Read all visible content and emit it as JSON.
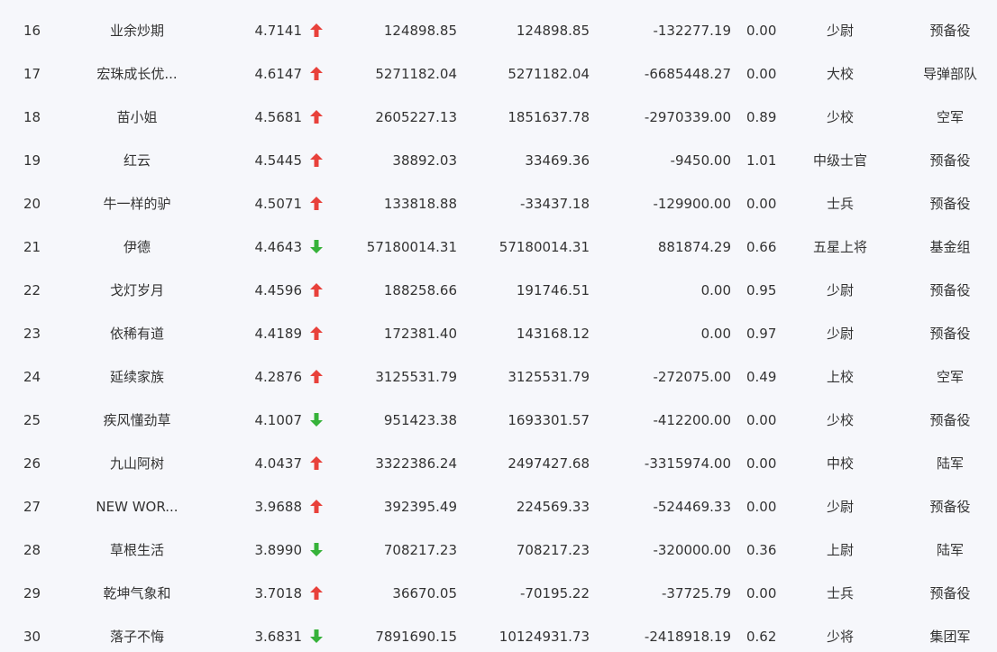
{
  "colors": {
    "background": "#f6f7fb",
    "text": "#333333",
    "up_arrow": "#e8413b",
    "down_arrow": "#36b23a"
  },
  "rows": [
    {
      "rank": "16",
      "name": "业余炒期",
      "score": "4.7141",
      "trend": "up",
      "trend_icon": "arrow-up-icon",
      "v1": "124898.85",
      "v2": "124898.85",
      "v3": "-132277.19",
      "ratio": "0.00",
      "rank_title": "少尉",
      "unit": "预备役"
    },
    {
      "rank": "17",
      "name": "宏珠成长优...",
      "score": "4.6147",
      "trend": "up",
      "trend_icon": "arrow-up-icon",
      "v1": "5271182.04",
      "v2": "5271182.04",
      "v3": "-6685448.27",
      "ratio": "0.00",
      "rank_title": "大校",
      "unit": "导弹部队"
    },
    {
      "rank": "18",
      "name": "苗小姐",
      "score": "4.5681",
      "trend": "up",
      "trend_icon": "arrow-up-icon",
      "v1": "2605227.13",
      "v2": "1851637.78",
      "v3": "-2970339.00",
      "ratio": "0.89",
      "rank_title": "少校",
      "unit": "空军"
    },
    {
      "rank": "19",
      "name": "红云",
      "score": "4.5445",
      "trend": "up",
      "trend_icon": "arrow-up-icon",
      "v1": "38892.03",
      "v2": "33469.36",
      "v3": "-9450.00",
      "ratio": "1.01",
      "rank_title": "中级士官",
      "unit": "预备役"
    },
    {
      "rank": "20",
      "name": "牛一样的驴",
      "score": "4.5071",
      "trend": "up",
      "trend_icon": "arrow-up-icon",
      "v1": "133818.88",
      "v2": "-33437.18",
      "v3": "-129900.00",
      "ratio": "0.00",
      "rank_title": "士兵",
      "unit": "预备役"
    },
    {
      "rank": "21",
      "name": "伊德",
      "score": "4.4643",
      "trend": "down",
      "trend_icon": "arrow-down-icon",
      "v1": "57180014.31",
      "v2": "57180014.31",
      "v3": "881874.29",
      "ratio": "0.66",
      "rank_title": "五星上将",
      "unit": "基金组"
    },
    {
      "rank": "22",
      "name": "戈灯岁月",
      "score": "4.4596",
      "trend": "up",
      "trend_icon": "arrow-up-icon",
      "v1": "188258.66",
      "v2": "191746.51",
      "v3": "0.00",
      "ratio": "0.95",
      "rank_title": "少尉",
      "unit": "预备役"
    },
    {
      "rank": "23",
      "name": "依稀有道",
      "score": "4.4189",
      "trend": "up",
      "trend_icon": "arrow-up-icon",
      "v1": "172381.40",
      "v2": "143168.12",
      "v3": "0.00",
      "ratio": "0.97",
      "rank_title": "少尉",
      "unit": "预备役"
    },
    {
      "rank": "24",
      "name": "延续家族",
      "score": "4.2876",
      "trend": "up",
      "trend_icon": "arrow-up-icon",
      "v1": "3125531.79",
      "v2": "3125531.79",
      "v3": "-272075.00",
      "ratio": "0.49",
      "rank_title": "上校",
      "unit": "空军"
    },
    {
      "rank": "25",
      "name": "疾风懂劲草",
      "score": "4.1007",
      "trend": "down",
      "trend_icon": "arrow-down-icon",
      "v1": "951423.38",
      "v2": "1693301.57",
      "v3": "-412200.00",
      "ratio": "0.00",
      "rank_title": "少校",
      "unit": "预备役"
    },
    {
      "rank": "26",
      "name": "九山阿树",
      "score": "4.0437",
      "trend": "up",
      "trend_icon": "arrow-up-icon",
      "v1": "3322386.24",
      "v2": "2497427.68",
      "v3": "-3315974.00",
      "ratio": "0.00",
      "rank_title": "中校",
      "unit": "陆军"
    },
    {
      "rank": "27",
      "name": "NEW WOR...",
      "score": "3.9688",
      "trend": "up",
      "trend_icon": "arrow-up-icon",
      "v1": "392395.49",
      "v2": "224569.33",
      "v3": "-524469.33",
      "ratio": "0.00",
      "rank_title": "少尉",
      "unit": "预备役"
    },
    {
      "rank": "28",
      "name": "草根生活",
      "score": "3.8990",
      "trend": "down",
      "trend_icon": "arrow-down-icon",
      "v1": "708217.23",
      "v2": "708217.23",
      "v3": "-320000.00",
      "ratio": "0.36",
      "rank_title": "上尉",
      "unit": "陆军"
    },
    {
      "rank": "29",
      "name": "乾坤气象和",
      "score": "3.7018",
      "trend": "up",
      "trend_icon": "arrow-up-icon",
      "v1": "36670.05",
      "v2": "-70195.22",
      "v3": "-37725.79",
      "ratio": "0.00",
      "rank_title": "士兵",
      "unit": "预备役"
    },
    {
      "rank": "30",
      "name": "落子不悔",
      "score": "3.6831",
      "trend": "down",
      "trend_icon": "arrow-down-icon",
      "v1": "7891690.15",
      "v2": "10124931.73",
      "v3": "-2418918.19",
      "ratio": "0.62",
      "rank_title": "少将",
      "unit": "集团军"
    }
  ]
}
